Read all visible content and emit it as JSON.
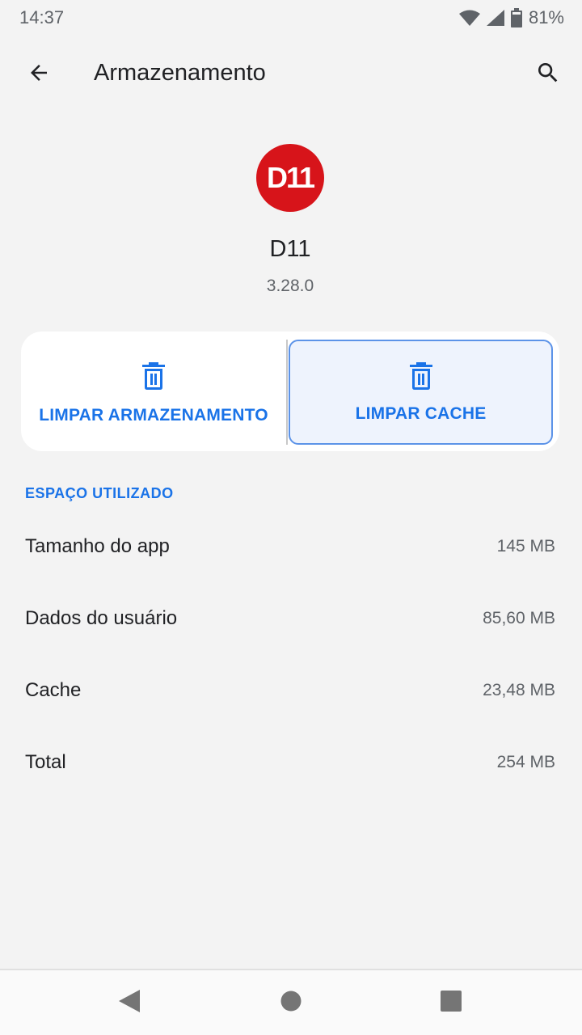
{
  "status_bar": {
    "time": "14:37",
    "battery": "81%",
    "icons": [
      "wifi-icon",
      "cell-signal-icon",
      "battery-icon"
    ]
  },
  "app_bar": {
    "title": "Armazenamento",
    "back_icon": "arrow-back-icon",
    "search_icon": "search-icon"
  },
  "app": {
    "logo_text": "D11",
    "name": "D11",
    "version": "3.28.0",
    "logo_color": "#d7141a"
  },
  "actions": {
    "clear_storage_label": "LIMPAR ARMAZENAMENTO",
    "clear_cache_label": "LIMPAR CACHE",
    "icon": "trash-icon",
    "accent_color": "#1a73e8"
  },
  "storage": {
    "section_title": "ESPAÇO UTILIZADO",
    "rows": [
      {
        "label": "Tamanho do app",
        "value": "145 MB"
      },
      {
        "label": "Dados do usuário",
        "value": "85,60 MB"
      },
      {
        "label": "Cache",
        "value": "23,48 MB"
      },
      {
        "label": "Total",
        "value": "254 MB"
      }
    ]
  },
  "nav_bar": {
    "icons": [
      "nav-back-icon",
      "nav-home-icon",
      "nav-recents-icon"
    ]
  }
}
